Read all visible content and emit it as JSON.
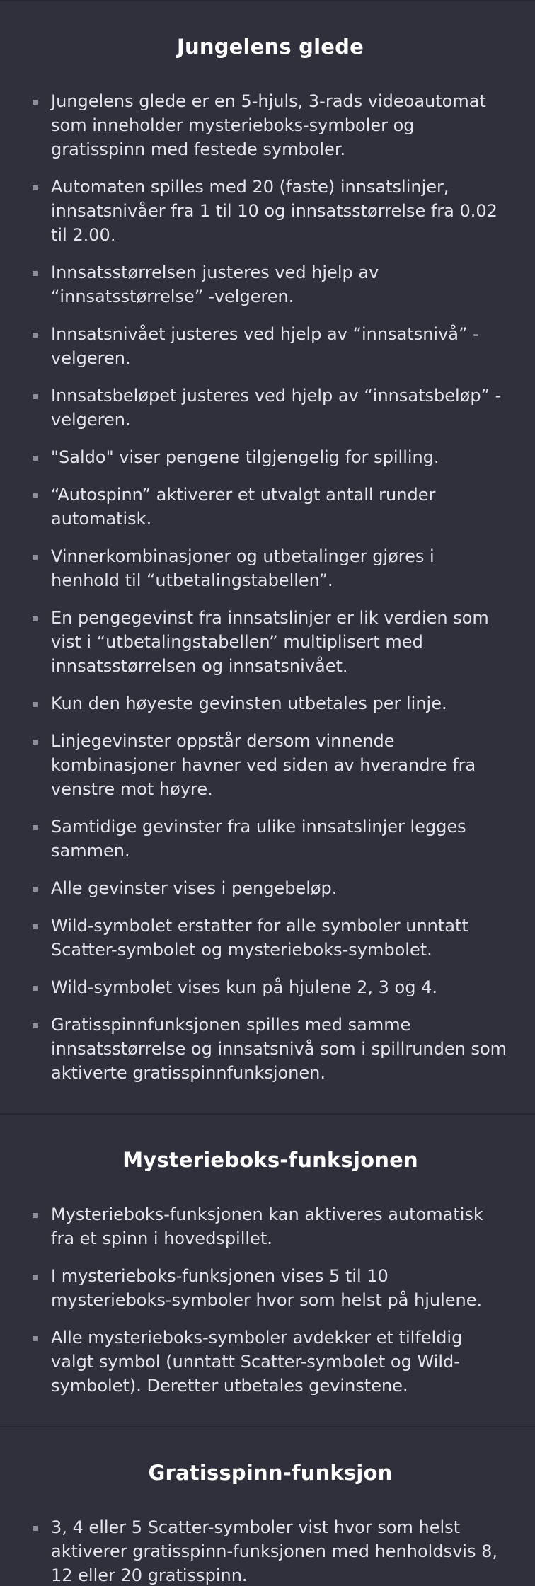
{
  "sections": [
    {
      "title": "Jungelens glede",
      "items": [
        "Jungelens glede er en 5-hjuls, 3-rads videoautomat som inneholder mysterieboks-symboler og gratisspinn med festede symboler.",
        "Automaten spilles med 20 (faste) innsatslinjer, innsatsnivåer fra 1 til 10 og innsatsstørrelse fra 0.02 til 2.00.",
        "Innsatsstørrelsen justeres ved hjelp av “innsatsstørrelse” -velgeren.",
        "Innsatsnivået justeres ved hjelp av “innsatsnivå” -velgeren.",
        "Innsatsbeløpet justeres ved hjelp av “innsatsbeløp” -velgeren.",
        "\"Saldo\" viser pengene tilgjengelig for spilling.",
        "“Autospinn” aktiverer et utvalgt antall runder automatisk.",
        "Vinnerkombinasjoner og utbetalinger gjøres i henhold til “utbetalingstabellen”.",
        "En pengegevinst fra innsatslinjer er lik verdien som vist i “utbetalingstabellen” multiplisert med innsatsstørrelsen og innsatsnivået.",
        "Kun den høyeste gevinsten utbetales per linje.",
        "Linjegevinster oppstår dersom vinnende kombinasjoner havner ved siden av hverandre fra venstre mot høyre.",
        "Samtidige gevinster fra ulike innsatslinjer legges sammen.",
        "Alle gevinster vises i pengebeløp.",
        "Wild-symbolet erstatter for alle symboler unntatt Scatter-symbolet og mysterieboks-symbolet.",
        "Wild-symbolet vises kun på hjulene 2, 3 og 4.",
        "Gratisspinnfunksjonen spilles med samme innsatsstørrelse og innsatsnivå som i spillrunden som aktiverte gratisspinnfunksjonen."
      ]
    },
    {
      "title": "Mysterieboks-funksjonen",
      "items": [
        "Mysterieboks-funksjonen kan aktiveres automatisk fra et spinn i hovedspillet.",
        "I mysterieboks-funksjonen vises 5 til 10 mysterieboks-symboler hvor som helst på hjulene.",
        "Alle mysterieboks-symboler avdekker et tilfeldig valgt symbol (unntatt Scatter-symbolet og Wild-symbolet). Deretter utbetales gevinstene."
      ]
    },
    {
      "title": "Gratisspinn-funksjon",
      "items": [
        "3, 4 eller 5 Scatter-symboler vist hvor som helst aktiverer gratisspinn-funksjonen med henholdsvis 8, 12 eller 20 gratisspinn."
      ]
    }
  ]
}
